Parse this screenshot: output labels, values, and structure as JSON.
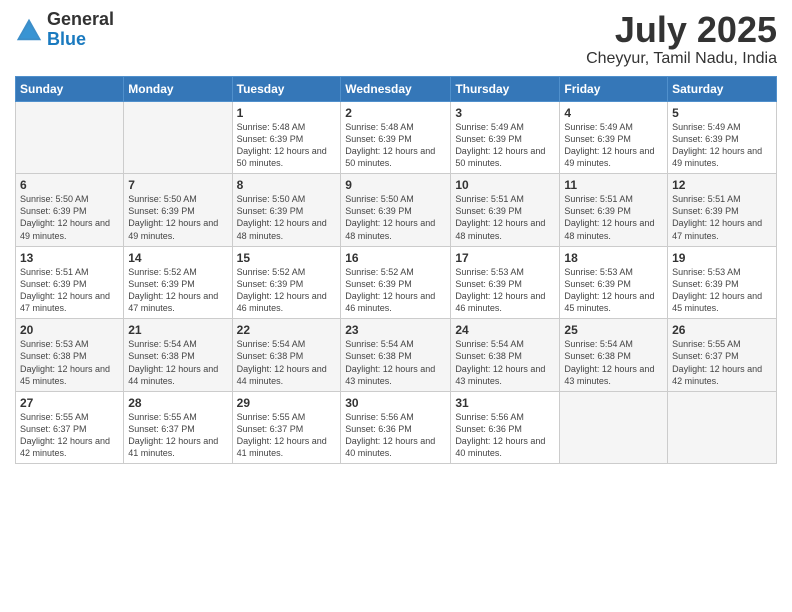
{
  "header": {
    "logo_general": "General",
    "logo_blue": "Blue",
    "month_title": "July 2025",
    "location": "Cheyyur, Tamil Nadu, India"
  },
  "days_of_week": [
    "Sunday",
    "Monday",
    "Tuesday",
    "Wednesday",
    "Thursday",
    "Friday",
    "Saturday"
  ],
  "weeks": [
    [
      {
        "day": "",
        "sunrise": "",
        "sunset": "",
        "daylight": ""
      },
      {
        "day": "",
        "sunrise": "",
        "sunset": "",
        "daylight": ""
      },
      {
        "day": "1",
        "sunrise": "Sunrise: 5:48 AM",
        "sunset": "Sunset: 6:39 PM",
        "daylight": "Daylight: 12 hours and 50 minutes."
      },
      {
        "day": "2",
        "sunrise": "Sunrise: 5:48 AM",
        "sunset": "Sunset: 6:39 PM",
        "daylight": "Daylight: 12 hours and 50 minutes."
      },
      {
        "day": "3",
        "sunrise": "Sunrise: 5:49 AM",
        "sunset": "Sunset: 6:39 PM",
        "daylight": "Daylight: 12 hours and 50 minutes."
      },
      {
        "day": "4",
        "sunrise": "Sunrise: 5:49 AM",
        "sunset": "Sunset: 6:39 PM",
        "daylight": "Daylight: 12 hours and 49 minutes."
      },
      {
        "day": "5",
        "sunrise": "Sunrise: 5:49 AM",
        "sunset": "Sunset: 6:39 PM",
        "daylight": "Daylight: 12 hours and 49 minutes."
      }
    ],
    [
      {
        "day": "6",
        "sunrise": "Sunrise: 5:50 AM",
        "sunset": "Sunset: 6:39 PM",
        "daylight": "Daylight: 12 hours and 49 minutes."
      },
      {
        "day": "7",
        "sunrise": "Sunrise: 5:50 AM",
        "sunset": "Sunset: 6:39 PM",
        "daylight": "Daylight: 12 hours and 49 minutes."
      },
      {
        "day": "8",
        "sunrise": "Sunrise: 5:50 AM",
        "sunset": "Sunset: 6:39 PM",
        "daylight": "Daylight: 12 hours and 48 minutes."
      },
      {
        "day": "9",
        "sunrise": "Sunrise: 5:50 AM",
        "sunset": "Sunset: 6:39 PM",
        "daylight": "Daylight: 12 hours and 48 minutes."
      },
      {
        "day": "10",
        "sunrise": "Sunrise: 5:51 AM",
        "sunset": "Sunset: 6:39 PM",
        "daylight": "Daylight: 12 hours and 48 minutes."
      },
      {
        "day": "11",
        "sunrise": "Sunrise: 5:51 AM",
        "sunset": "Sunset: 6:39 PM",
        "daylight": "Daylight: 12 hours and 48 minutes."
      },
      {
        "day": "12",
        "sunrise": "Sunrise: 5:51 AM",
        "sunset": "Sunset: 6:39 PM",
        "daylight": "Daylight: 12 hours and 47 minutes."
      }
    ],
    [
      {
        "day": "13",
        "sunrise": "Sunrise: 5:51 AM",
        "sunset": "Sunset: 6:39 PM",
        "daylight": "Daylight: 12 hours and 47 minutes."
      },
      {
        "day": "14",
        "sunrise": "Sunrise: 5:52 AM",
        "sunset": "Sunset: 6:39 PM",
        "daylight": "Daylight: 12 hours and 47 minutes."
      },
      {
        "day": "15",
        "sunrise": "Sunrise: 5:52 AM",
        "sunset": "Sunset: 6:39 PM",
        "daylight": "Daylight: 12 hours and 46 minutes."
      },
      {
        "day": "16",
        "sunrise": "Sunrise: 5:52 AM",
        "sunset": "Sunset: 6:39 PM",
        "daylight": "Daylight: 12 hours and 46 minutes."
      },
      {
        "day": "17",
        "sunrise": "Sunrise: 5:53 AM",
        "sunset": "Sunset: 6:39 PM",
        "daylight": "Daylight: 12 hours and 46 minutes."
      },
      {
        "day": "18",
        "sunrise": "Sunrise: 5:53 AM",
        "sunset": "Sunset: 6:39 PM",
        "daylight": "Daylight: 12 hours and 45 minutes."
      },
      {
        "day": "19",
        "sunrise": "Sunrise: 5:53 AM",
        "sunset": "Sunset: 6:39 PM",
        "daylight": "Daylight: 12 hours and 45 minutes."
      }
    ],
    [
      {
        "day": "20",
        "sunrise": "Sunrise: 5:53 AM",
        "sunset": "Sunset: 6:38 PM",
        "daylight": "Daylight: 12 hours and 45 minutes."
      },
      {
        "day": "21",
        "sunrise": "Sunrise: 5:54 AM",
        "sunset": "Sunset: 6:38 PM",
        "daylight": "Daylight: 12 hours and 44 minutes."
      },
      {
        "day": "22",
        "sunrise": "Sunrise: 5:54 AM",
        "sunset": "Sunset: 6:38 PM",
        "daylight": "Daylight: 12 hours and 44 minutes."
      },
      {
        "day": "23",
        "sunrise": "Sunrise: 5:54 AM",
        "sunset": "Sunset: 6:38 PM",
        "daylight": "Daylight: 12 hours and 43 minutes."
      },
      {
        "day": "24",
        "sunrise": "Sunrise: 5:54 AM",
        "sunset": "Sunset: 6:38 PM",
        "daylight": "Daylight: 12 hours and 43 minutes."
      },
      {
        "day": "25",
        "sunrise": "Sunrise: 5:54 AM",
        "sunset": "Sunset: 6:38 PM",
        "daylight": "Daylight: 12 hours and 43 minutes."
      },
      {
        "day": "26",
        "sunrise": "Sunrise: 5:55 AM",
        "sunset": "Sunset: 6:37 PM",
        "daylight": "Daylight: 12 hours and 42 minutes."
      }
    ],
    [
      {
        "day": "27",
        "sunrise": "Sunrise: 5:55 AM",
        "sunset": "Sunset: 6:37 PM",
        "daylight": "Daylight: 12 hours and 42 minutes."
      },
      {
        "day": "28",
        "sunrise": "Sunrise: 5:55 AM",
        "sunset": "Sunset: 6:37 PM",
        "daylight": "Daylight: 12 hours and 41 minutes."
      },
      {
        "day": "29",
        "sunrise": "Sunrise: 5:55 AM",
        "sunset": "Sunset: 6:37 PM",
        "daylight": "Daylight: 12 hours and 41 minutes."
      },
      {
        "day": "30",
        "sunrise": "Sunrise: 5:56 AM",
        "sunset": "Sunset: 6:36 PM",
        "daylight": "Daylight: 12 hours and 40 minutes."
      },
      {
        "day": "31",
        "sunrise": "Sunrise: 5:56 AM",
        "sunset": "Sunset: 6:36 PM",
        "daylight": "Daylight: 12 hours and 40 minutes."
      },
      {
        "day": "",
        "sunrise": "",
        "sunset": "",
        "daylight": ""
      },
      {
        "day": "",
        "sunrise": "",
        "sunset": "",
        "daylight": ""
      }
    ]
  ]
}
